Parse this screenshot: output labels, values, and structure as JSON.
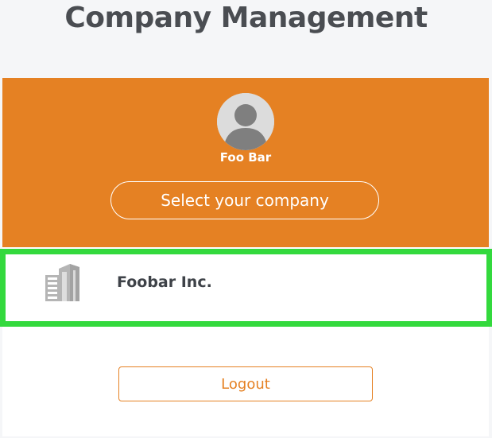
{
  "header": {
    "title": "Company Management"
  },
  "profile": {
    "user_name": "Foo Bar",
    "avatar_icon": "user-avatar-icon",
    "select_company_label": "Select your company",
    "background_color": "#e58123"
  },
  "companies": [
    {
      "name": "Foobar Inc.",
      "icon": "building-icon",
      "selected": true
    }
  ],
  "footer": {
    "logout_label": "Logout"
  },
  "colors": {
    "accent": "#e58123",
    "selection_border": "#33d93d",
    "title_text": "#4a4d52"
  }
}
